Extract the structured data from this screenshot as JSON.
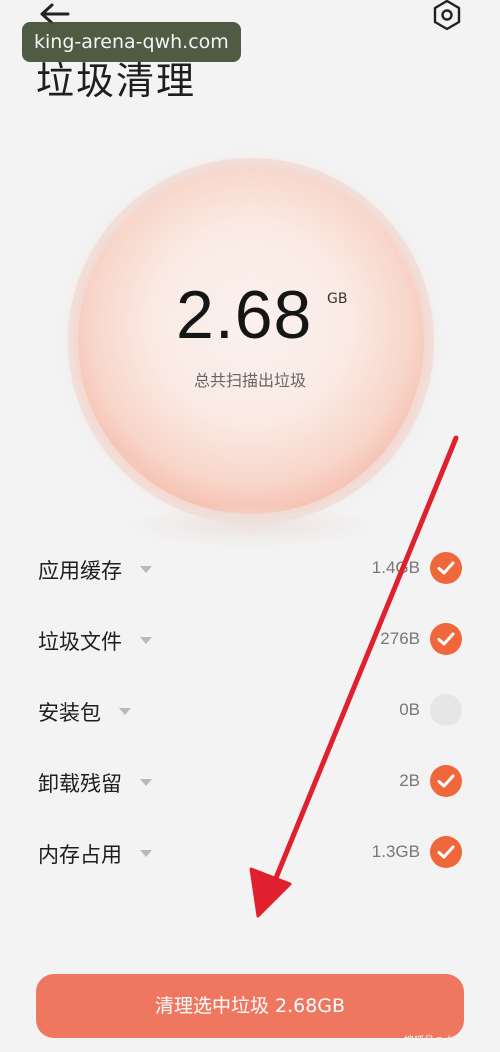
{
  "header": {
    "title": "垃圾清理",
    "back_icon": "arrow-left-icon",
    "settings_icon": "gear-icon"
  },
  "watermark": {
    "top": "king-arena-qwh.com",
    "bottom": "搜狐号@小段爱分享"
  },
  "summary": {
    "total_value": "2.68",
    "total_unit": "GB",
    "caption": "总共扫描出垃圾"
  },
  "items": [
    {
      "label": "应用缓存",
      "size": "1.4GB",
      "checked": true
    },
    {
      "label": "垃圾文件",
      "size": "276B",
      "checked": true
    },
    {
      "label": "安装包",
      "size": "0B",
      "checked": false
    },
    {
      "label": "卸载残留",
      "size": "2B",
      "checked": true
    },
    {
      "label": "内存占用",
      "size": "1.3GB",
      "checked": true
    }
  ],
  "actions": {
    "clean_label": "清理选中垃圾 2.68GB"
  },
  "colors": {
    "accent": "#f0673c",
    "button": "#ef7760",
    "arrow": "#e0202e"
  }
}
